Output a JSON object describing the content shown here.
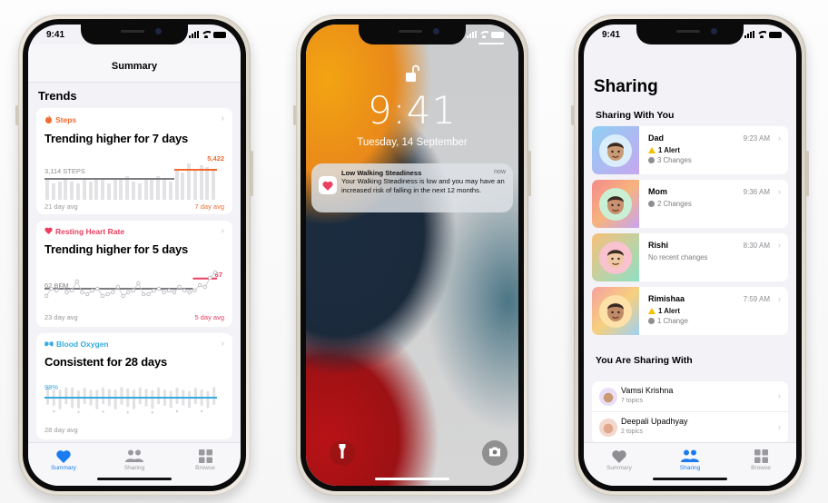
{
  "status_time": "9:41",
  "summary_phone": {
    "nav_title": "Summary",
    "section_title": "Trends",
    "cards": [
      {
        "category": "Steps",
        "category_color": "#f26a2e",
        "icon": "flame-icon",
        "headline": "Trending higher for 7 days",
        "left_label": "3,114 STEPS",
        "right_label": "5,422",
        "left_foot": "21 day avg",
        "right_foot": "7 day avg",
        "daily_values": [
          0.55,
          0.45,
          0.5,
          0.6,
          0.5,
          0.45,
          0.55,
          0.5,
          0.55,
          0.6,
          0.45,
          0.55,
          0.6,
          0.65,
          0.5,
          0.45,
          0.55,
          0.55,
          0.65,
          0.55,
          0.5,
          0.85,
          0.75,
          1.0,
          0.85,
          0.95,
          0.9,
          0.8
        ],
        "avg_old": 0.55,
        "avg_new": 0.8
      },
      {
        "category": "Resting Heart Rate",
        "category_color": "#ea3f61",
        "icon": "heart-icon",
        "headline": "Trending higher for 5 days",
        "left_label": "62 BPM",
        "right_label": "67",
        "left_foot": "23 day avg",
        "right_foot": "5 day avg",
        "daily_values": [
          0.3,
          0.5,
          0.45,
          0.6,
          0.4,
          0.45,
          0.7,
          0.4,
          0.35,
          0.45,
          0.5,
          0.3,
          0.35,
          0.4,
          0.55,
          0.3,
          0.4,
          0.45,
          0.65,
          0.35,
          0.35,
          0.45,
          0.5,
          0.4,
          0.45,
          0.4,
          0.55,
          0.45,
          0.4,
          0.45,
          0.6,
          0.55,
          0.8,
          0.95
        ],
        "avg_old": 0.5,
        "avg_new": 0.78
      },
      {
        "category": "Blood Oxygen",
        "category_color": "#35aadf",
        "icon": "lungs-icon",
        "headline": "Consistent for 28 days",
        "left_label": "98%",
        "right_label": "",
        "left_foot": "28 day avg",
        "right_foot": "",
        "daily_values": [
          0.6,
          0.5,
          0.7,
          0.55,
          0.8,
          0.6,
          0.5,
          0.45,
          0.7,
          0.55,
          0.55,
          0.75,
          0.6,
          0.65,
          0.7,
          0.55,
          0.6,
          0.65,
          0.55,
          0.5,
          0.55,
          0.5,
          0.45,
          0.55,
          0.5,
          0.5,
          0.55,
          0.6
        ],
        "avg_old": 0.6,
        "avg_new": 0.6
      }
    ],
    "tabs": [
      {
        "label": "Summary",
        "icon": "heart-icon",
        "active": true
      },
      {
        "label": "Sharing",
        "icon": "people-icon",
        "active": false
      },
      {
        "label": "Browse",
        "icon": "grid-icon",
        "active": false
      }
    ]
  },
  "lock_phone": {
    "time": "9:41",
    "date": "Tuesday, 14 September",
    "notification": {
      "title": "Low Walking Steadiness",
      "body": "Your Walking Steadiness is low and you may have an increased risk of falling in the next 12 months.",
      "time": "now",
      "app_icon": "health-heart-icon"
    },
    "flashlight_icon": "flashlight-icon",
    "camera_icon": "camera-icon"
  },
  "sharing_phone": {
    "title": "Sharing",
    "with_you_title": "Sharing With You",
    "people": [
      {
        "name": "Dad",
        "time": "9:23 AM",
        "alert": "1 Alert",
        "changes": "3 Changes",
        "bg": "linear-gradient(135deg,#8fd0f3,#c6a6f0)",
        "avatar_bg": "#d9eefa",
        "skin": "#c99a74"
      },
      {
        "name": "Mom",
        "time": "9:36 AM",
        "alert": "",
        "changes": "2 Changes",
        "bg": "linear-gradient(135deg,#f48b8b,#f6b37e,#c7a4f2)",
        "avatar_bg": "#c9f0d4",
        "skin": "#c8906e"
      },
      {
        "name": "Rishi",
        "time": "8:30 AM",
        "alert": "",
        "changes": "No recent changes",
        "bg": "linear-gradient(135deg,#f8c07a,#8fe0c4)",
        "avatar_bg": "#f8c3cf",
        "skin": "#f0c7a4"
      },
      {
        "name": "Rimishaa",
        "time": "7:59 AM",
        "alert": "1 Alert",
        "changes": "1 Change",
        "bg": "linear-gradient(135deg,#f6a0a0,#f7d07e,#9ed0f3)",
        "avatar_bg": "#fde1a8",
        "skin": "#c08a67"
      }
    ],
    "you_share_title": "You Are Sharing With",
    "sharing_with": [
      {
        "name": "Vamsi Krishna",
        "topics": "7 topics"
      },
      {
        "name": "Deepali Upadhyay",
        "topics": "2 topics"
      }
    ],
    "tabs": [
      {
        "label": "Summary",
        "icon": "heart-icon",
        "active": false
      },
      {
        "label": "Sharing",
        "icon": "people-icon",
        "active": true
      },
      {
        "label": "Browse",
        "icon": "grid-icon",
        "active": false
      }
    ]
  }
}
